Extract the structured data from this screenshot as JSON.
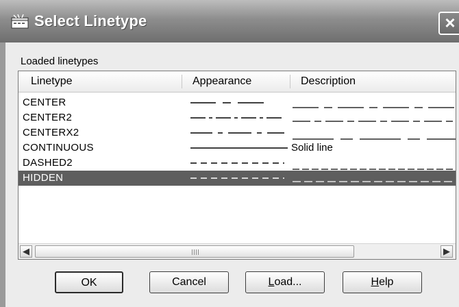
{
  "window": {
    "title": "Select Linetype"
  },
  "section_label": "Loaded linetypes",
  "columns": [
    "Linetype",
    "Appearance",
    "Description"
  ],
  "rows": [
    {
      "name": "CENTER",
      "description": "",
      "appearance": "center",
      "selected": false
    },
    {
      "name": "CENTER2",
      "description": "",
      "appearance": "center2",
      "selected": false
    },
    {
      "name": "CENTERX2",
      "description": "",
      "appearance": "centerx2",
      "selected": false
    },
    {
      "name": "CONTINUOUS",
      "description": "Solid line",
      "appearance": "continuous",
      "selected": false
    },
    {
      "name": "DASHED2",
      "description": "",
      "appearance": "dashed2",
      "selected": false
    },
    {
      "name": "HIDDEN",
      "description": "",
      "appearance": "hidden",
      "selected": true
    }
  ],
  "buttons": {
    "ok": {
      "label": "OK"
    },
    "cancel": {
      "label": "Cancel"
    },
    "load": {
      "first": "L",
      "rest": "oad..."
    },
    "help": {
      "first": "H",
      "rest": "elp"
    }
  },
  "icons": {
    "title": "linetype-dialog-icon",
    "close": "close-icon",
    "scroll_left": "arrow-left-icon",
    "scroll_right": "arrow-right-icon"
  },
  "colors": {
    "selection": "#5e5e5e",
    "titlebar": "#8d8d8d"
  }
}
